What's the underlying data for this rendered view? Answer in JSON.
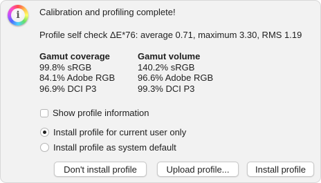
{
  "dialog": {
    "icon": "color-info-icon",
    "icon_glyph": "i",
    "title": "Calibration and profiling complete!",
    "self_check": "Profile self check ΔE*76: average 0.71, maximum 3.30, RMS 1.19",
    "gamut_coverage": {
      "heading": "Gamut coverage",
      "rows": [
        "99.8% sRGB",
        "84.1% Adobe RGB",
        "96.9% DCI P3"
      ]
    },
    "gamut_volume": {
      "heading": "Gamut volume",
      "rows": [
        "140.2% sRGB",
        "96.6% Adobe RGB",
        "99.3% DCI P3"
      ]
    },
    "show_profile_info": {
      "label": "Show profile information",
      "checked": false
    },
    "install_scope": {
      "options": [
        {
          "label": "Install profile for current user only",
          "selected": true
        },
        {
          "label": "Install profile as system default",
          "selected": false
        }
      ]
    },
    "buttons": {
      "dont_install": "Don't install profile",
      "upload": "Upload profile...",
      "install": "Install profile"
    }
  }
}
